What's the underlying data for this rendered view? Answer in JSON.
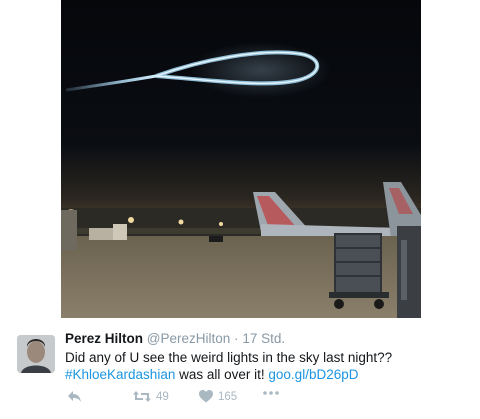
{
  "tweet": {
    "name": "Perez Hilton",
    "handle": "@PerezHilton",
    "separator": "·",
    "time": "17 Std.",
    "text_before": "Did any of U see the weird lights in the sky last night??",
    "hashtag": "#KhloeKardashian",
    "text_after": "was all over it!",
    "link": "goo.gl/bD26pD"
  },
  "actions": {
    "reply_icon": "reply-icon",
    "retweet_icon": "retweet-icon",
    "retweet_count": "49",
    "like_icon": "heart-icon",
    "like_count": "165",
    "more_icon": "more-icon"
  },
  "colors": {
    "link": "#1b95e0",
    "muted": "#8899a6",
    "action": "#aab8c2",
    "night_sky": "#06080c",
    "light_trail": "#9fd3f2"
  }
}
